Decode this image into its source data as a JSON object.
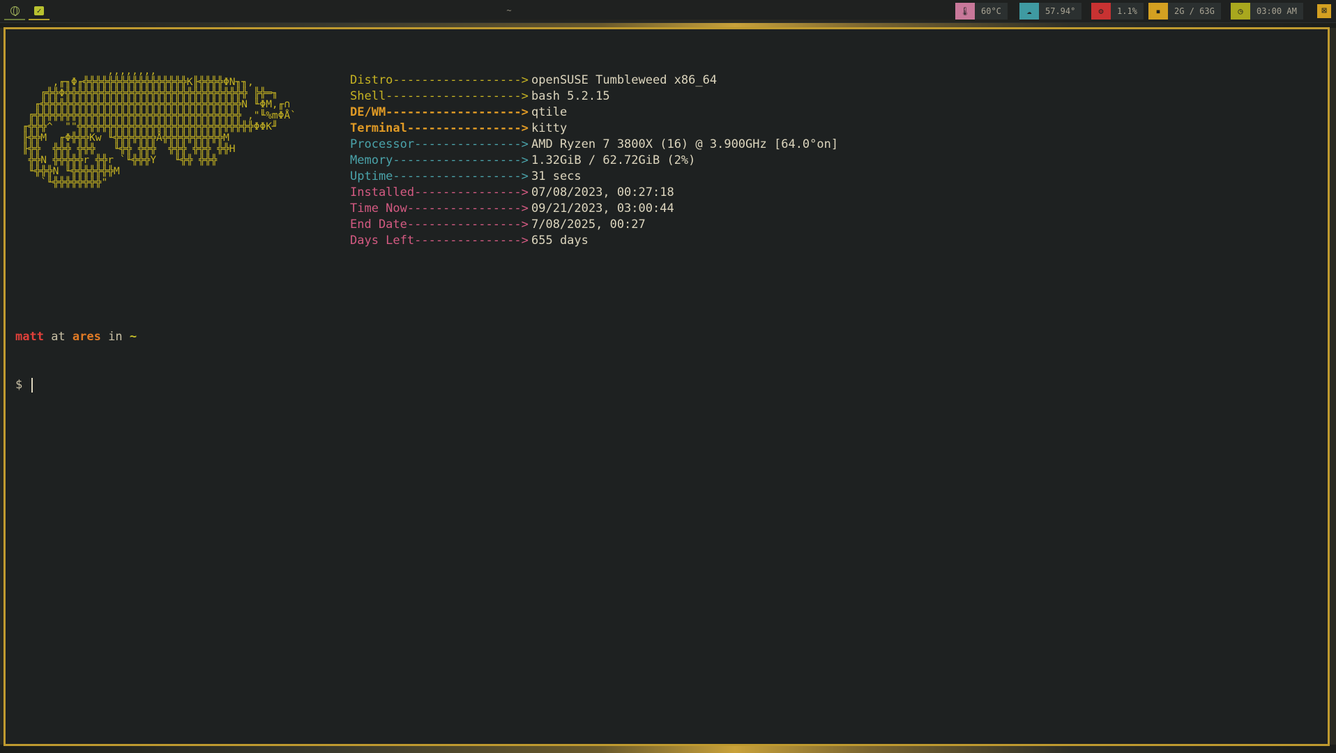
{
  "topbar": {
    "window_title": "~",
    "temperature": "60°C",
    "network": "57.94°",
    "cpu": "1.1%",
    "memory": "2G / 63G",
    "clock": "03:00 AM"
  },
  "terminal": {
    "info": [
      {
        "key": "Distro------------------>",
        "value": "openSUSE Tumbleweed x86_64"
      },
      {
        "key": "Shell------------------->",
        "value": "bash 5.2.15"
      },
      {
        "key": "DE/WM------------------->",
        "value": "qtile"
      },
      {
        "key": "Terminal---------------->",
        "value": "kitty"
      },
      {
        "key": "Processor--------------->",
        "value": "AMD Ryzen 7 3800X (16) @ 3.900GHz [64.0°on]"
      },
      {
        "key": "Memory------------------>",
        "value": "1.32GiB / 62.72GiB (2%)"
      },
      {
        "key": "Uptime------------------>",
        "value": "31 secs"
      },
      {
        "key": "Installed--------------->",
        "value": "07/08/2023, 00:27:18"
      },
      {
        "key": "Time Now---------------->",
        "value": "09/21/2023, 03:00:44"
      },
      {
        "key": "End Date---------------->",
        "value": "7/08/2025, 00:27"
      },
      {
        "key": "Days Left--------------->",
        "value": "655 days"
      }
    ],
    "prompt": {
      "user": "matt",
      "at": " at ",
      "host": "ares",
      "in": " in ",
      "dir": "~",
      "symbol": "$ "
    }
  },
  "colors": {
    "accent": "#bf9a2f",
    "background": "#1e2121",
    "label_yellow": "#c6b322",
    "label_orange": "#e09a25",
    "label_cyan": "#4aa3aa",
    "label_pink": "#d45a82"
  },
  "icons": [
    "globe-icon",
    "checkbox-icon",
    "thermometer-icon",
    "cloud-icon",
    "cpu-icon",
    "memory-icon",
    "clock-icon",
    "close-icon"
  ]
}
